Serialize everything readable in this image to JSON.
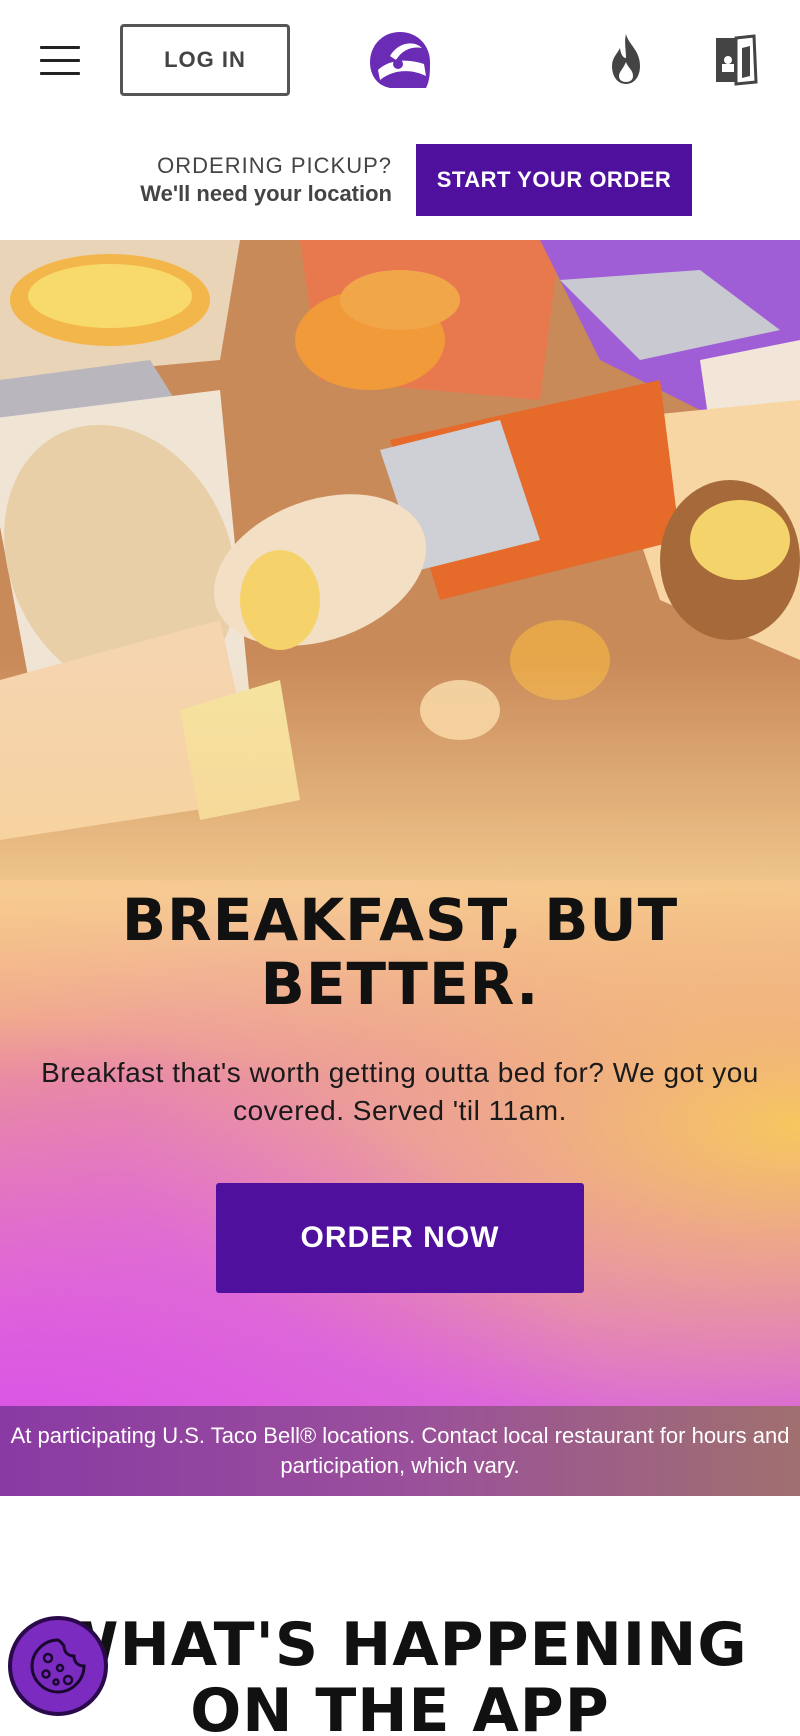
{
  "header": {
    "login_label": "LOG IN",
    "icons": {
      "menu": "hamburger-menu-icon",
      "logo": "taco-bell-logo",
      "hot": "fire-icon",
      "nav_menu": "menu-book-icon"
    }
  },
  "pickup": {
    "question": "ORDERING PICKUP?",
    "location_note": "We'll need your location",
    "start_label": "START YOUR ORDER"
  },
  "hero": {
    "title": "BREAKFAST, BUT BETTER.",
    "description": "Breakfast that's worth getting outta bed for? We got you covered. Served 'til 11am.",
    "order_label": "ORDER NOW"
  },
  "disclaimer": "At participating U.S. Taco Bell® locations. Contact local restaurant for hours and participation, which vary.",
  "app_section": {
    "title": "WHAT'S HAPPENING ON THE APP"
  },
  "colors": {
    "brand_purple": "#4f109d",
    "cookie_purple": "#7b2bbf"
  }
}
